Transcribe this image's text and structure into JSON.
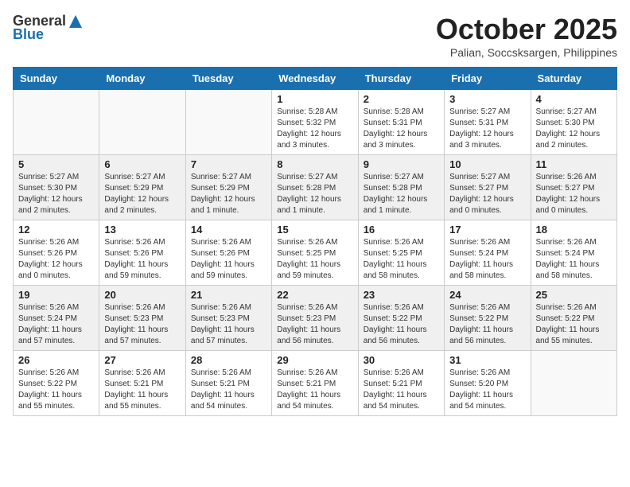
{
  "logo": {
    "general": "General",
    "blue": "Blue"
  },
  "header": {
    "month": "October 2025",
    "location": "Palian, Soccsksargen, Philippines"
  },
  "weekdays": [
    "Sunday",
    "Monday",
    "Tuesday",
    "Wednesday",
    "Thursday",
    "Friday",
    "Saturday"
  ],
  "weeks": [
    [
      {
        "day": "",
        "info": ""
      },
      {
        "day": "",
        "info": ""
      },
      {
        "day": "",
        "info": ""
      },
      {
        "day": "1",
        "info": "Sunrise: 5:28 AM\nSunset: 5:32 PM\nDaylight: 12 hours\nand 3 minutes."
      },
      {
        "day": "2",
        "info": "Sunrise: 5:28 AM\nSunset: 5:31 PM\nDaylight: 12 hours\nand 3 minutes."
      },
      {
        "day": "3",
        "info": "Sunrise: 5:27 AM\nSunset: 5:31 PM\nDaylight: 12 hours\nand 3 minutes."
      },
      {
        "day": "4",
        "info": "Sunrise: 5:27 AM\nSunset: 5:30 PM\nDaylight: 12 hours\nand 2 minutes."
      }
    ],
    [
      {
        "day": "5",
        "info": "Sunrise: 5:27 AM\nSunset: 5:30 PM\nDaylight: 12 hours\nand 2 minutes."
      },
      {
        "day": "6",
        "info": "Sunrise: 5:27 AM\nSunset: 5:29 PM\nDaylight: 12 hours\nand 2 minutes."
      },
      {
        "day": "7",
        "info": "Sunrise: 5:27 AM\nSunset: 5:29 PM\nDaylight: 12 hours\nand 1 minute."
      },
      {
        "day": "8",
        "info": "Sunrise: 5:27 AM\nSunset: 5:28 PM\nDaylight: 12 hours\nand 1 minute."
      },
      {
        "day": "9",
        "info": "Sunrise: 5:27 AM\nSunset: 5:28 PM\nDaylight: 12 hours\nand 1 minute."
      },
      {
        "day": "10",
        "info": "Sunrise: 5:27 AM\nSunset: 5:27 PM\nDaylight: 12 hours\nand 0 minutes."
      },
      {
        "day": "11",
        "info": "Sunrise: 5:26 AM\nSunset: 5:27 PM\nDaylight: 12 hours\nand 0 minutes."
      }
    ],
    [
      {
        "day": "12",
        "info": "Sunrise: 5:26 AM\nSunset: 5:26 PM\nDaylight: 12 hours\nand 0 minutes."
      },
      {
        "day": "13",
        "info": "Sunrise: 5:26 AM\nSunset: 5:26 PM\nDaylight: 11 hours\nand 59 minutes."
      },
      {
        "day": "14",
        "info": "Sunrise: 5:26 AM\nSunset: 5:26 PM\nDaylight: 11 hours\nand 59 minutes."
      },
      {
        "day": "15",
        "info": "Sunrise: 5:26 AM\nSunset: 5:25 PM\nDaylight: 11 hours\nand 59 minutes."
      },
      {
        "day": "16",
        "info": "Sunrise: 5:26 AM\nSunset: 5:25 PM\nDaylight: 11 hours\nand 58 minutes."
      },
      {
        "day": "17",
        "info": "Sunrise: 5:26 AM\nSunset: 5:24 PM\nDaylight: 11 hours\nand 58 minutes."
      },
      {
        "day": "18",
        "info": "Sunrise: 5:26 AM\nSunset: 5:24 PM\nDaylight: 11 hours\nand 58 minutes."
      }
    ],
    [
      {
        "day": "19",
        "info": "Sunrise: 5:26 AM\nSunset: 5:24 PM\nDaylight: 11 hours\nand 57 minutes."
      },
      {
        "day": "20",
        "info": "Sunrise: 5:26 AM\nSunset: 5:23 PM\nDaylight: 11 hours\nand 57 minutes."
      },
      {
        "day": "21",
        "info": "Sunrise: 5:26 AM\nSunset: 5:23 PM\nDaylight: 11 hours\nand 57 minutes."
      },
      {
        "day": "22",
        "info": "Sunrise: 5:26 AM\nSunset: 5:23 PM\nDaylight: 11 hours\nand 56 minutes."
      },
      {
        "day": "23",
        "info": "Sunrise: 5:26 AM\nSunset: 5:22 PM\nDaylight: 11 hours\nand 56 minutes."
      },
      {
        "day": "24",
        "info": "Sunrise: 5:26 AM\nSunset: 5:22 PM\nDaylight: 11 hours\nand 56 minutes."
      },
      {
        "day": "25",
        "info": "Sunrise: 5:26 AM\nSunset: 5:22 PM\nDaylight: 11 hours\nand 55 minutes."
      }
    ],
    [
      {
        "day": "26",
        "info": "Sunrise: 5:26 AM\nSunset: 5:22 PM\nDaylight: 11 hours\nand 55 minutes."
      },
      {
        "day": "27",
        "info": "Sunrise: 5:26 AM\nSunset: 5:21 PM\nDaylight: 11 hours\nand 55 minutes."
      },
      {
        "day": "28",
        "info": "Sunrise: 5:26 AM\nSunset: 5:21 PM\nDaylight: 11 hours\nand 54 minutes."
      },
      {
        "day": "29",
        "info": "Sunrise: 5:26 AM\nSunset: 5:21 PM\nDaylight: 11 hours\nand 54 minutes."
      },
      {
        "day": "30",
        "info": "Sunrise: 5:26 AM\nSunset: 5:21 PM\nDaylight: 11 hours\nand 54 minutes."
      },
      {
        "day": "31",
        "info": "Sunrise: 5:26 AM\nSunset: 5:20 PM\nDaylight: 11 hours\nand 54 minutes."
      },
      {
        "day": "",
        "info": ""
      }
    ]
  ]
}
